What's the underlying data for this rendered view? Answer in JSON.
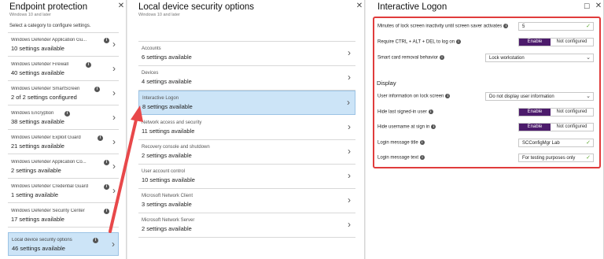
{
  "blade1": {
    "title": "Endpoint protection",
    "subtitle": "Windows 10 and later",
    "instruction": "Select a category to configure settings.",
    "items": [
      {
        "name": "Windows Defender Application Gu...",
        "count": "10 settings available"
      },
      {
        "name": "Windows Defender Firewall",
        "count": "40 settings available"
      },
      {
        "name": "Windows Defender SmartScreen",
        "count": "2 of 2 settings configured"
      },
      {
        "name": "Windows Encryption",
        "count": "38 settings available"
      },
      {
        "name": "Windows Defender Exploit Guard",
        "count": "21 settings available"
      },
      {
        "name": "Windows Defender Application Co...",
        "count": "2 settings available"
      },
      {
        "name": "Windows Defender Credential Guard",
        "count": "1 setting available"
      },
      {
        "name": "Windows Defender Security Center",
        "count": "17 settings available"
      },
      {
        "name": "Local device security options",
        "count": "46 settings available"
      }
    ]
  },
  "blade2": {
    "title": "Local device security options",
    "subtitle": "Windows 10 and later",
    "items": [
      {
        "name": "Accounts",
        "count": "6 settings available"
      },
      {
        "name": "Devices",
        "count": "4 settings available"
      },
      {
        "name": "Interactive Logon",
        "count": "8 settings available"
      },
      {
        "name": "Network access and security",
        "count": "11 settings available"
      },
      {
        "name": "Recovery console and shutdown",
        "count": "2 settings available"
      },
      {
        "name": "User account control",
        "count": "10 settings available"
      },
      {
        "name": "Microsoft Network Client",
        "count": "3 settings available"
      },
      {
        "name": "Microsoft Network Server",
        "count": "2 settings available"
      }
    ]
  },
  "blade3": {
    "title": "Interactive Logon",
    "display_section": "Display",
    "settings": {
      "lock_inactivity_label": "Minutes of lock screen inactivity until screen saver activates",
      "lock_inactivity_value": "5",
      "ctrl_alt_del_label": "Require CTRL + ALT + DEL to log on",
      "smart_card_label": "Smart card removal behavior",
      "smart_card_value": "Lock workstation",
      "user_info_label": "User information on lock screen",
      "user_info_value": "Do not display user information",
      "hide_last_user_label": "Hide last signed-in user",
      "hide_username_label": "Hide username at sign in",
      "login_title_label": "Login message title",
      "login_title_value": "SCConfigMgr Lab",
      "login_text_label": "Login message text",
      "login_text_value": "For testing purposes only"
    },
    "toggle": {
      "on": "Enable",
      "off": "Not configured"
    }
  },
  "colors": {
    "accent": "#4c1b6b",
    "selected_bg": "#cce4f7",
    "highlight": "#e03c3c",
    "check": "#5ea830"
  }
}
